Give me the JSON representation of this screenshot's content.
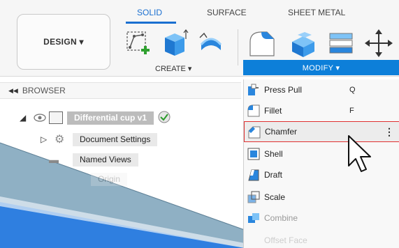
{
  "toolbar": {
    "design_label": "DESIGN ▾",
    "tabs": [
      {
        "label": "SOLID",
        "active": true
      },
      {
        "label": "SURFACE",
        "active": false
      },
      {
        "label": "SHEET METAL",
        "active": false
      }
    ],
    "create_label": "CREATE ▾",
    "modify_label": "MODIFY ▾"
  },
  "browser": {
    "title": "BROWSER",
    "root": {
      "label": "Differential cup v1"
    },
    "items": [
      {
        "label": "Document Settings"
      },
      {
        "label": "Named Views"
      },
      {
        "label": "Origin"
      }
    ]
  },
  "modify_menu": {
    "items": [
      {
        "label": "Press Pull",
        "shortcut": "Q"
      },
      {
        "label": "Fillet",
        "shortcut": "F"
      },
      {
        "label": "Chamfer",
        "shortcut": "",
        "more": "⋮",
        "highlighted": true
      },
      {
        "label": "Shell",
        "shortcut": ""
      },
      {
        "label": "Draft",
        "shortcut": ""
      },
      {
        "label": "Scale",
        "shortcut": ""
      },
      {
        "label": "Combine",
        "shortcut": ""
      },
      {
        "label": "Offset Face",
        "shortcut": ""
      }
    ]
  },
  "colors": {
    "accent": "#1a6fd0",
    "modify_bar": "#0d7fd9",
    "highlight_border": "#e03030",
    "body_blue": "#2f7fe0",
    "body_slate": "#8fb0c4"
  }
}
